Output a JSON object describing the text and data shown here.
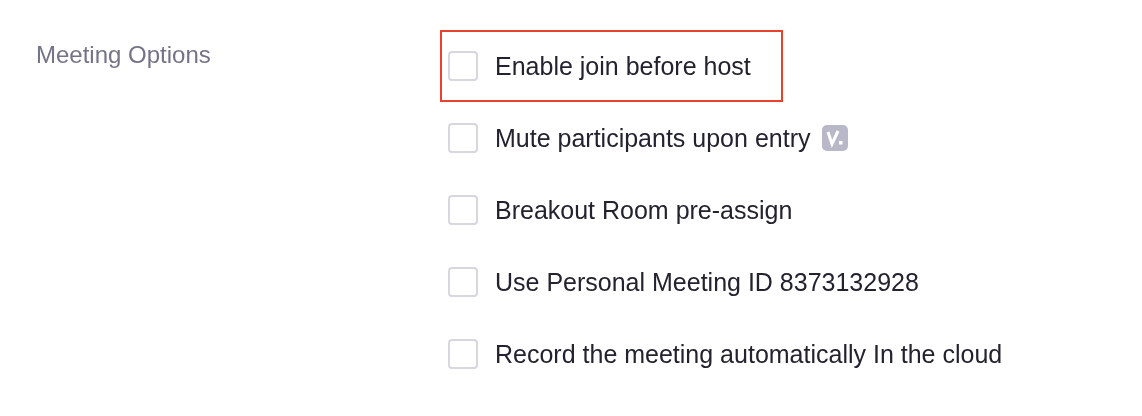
{
  "section_label": "Meeting Options",
  "options": [
    {
      "label": "Enable join before host",
      "checked": false,
      "highlighted": true,
      "badge": false
    },
    {
      "label": "Mute participants upon entry",
      "checked": false,
      "highlighted": false,
      "badge": true
    },
    {
      "label": "Breakout Room pre-assign",
      "checked": false,
      "highlighted": false,
      "badge": false
    },
    {
      "label": "Use Personal Meeting ID 8373132928",
      "checked": false,
      "highlighted": false,
      "badge": false
    },
    {
      "label": "Record the meeting automatically In the cloud",
      "checked": false,
      "highlighted": false,
      "badge": false
    }
  ]
}
